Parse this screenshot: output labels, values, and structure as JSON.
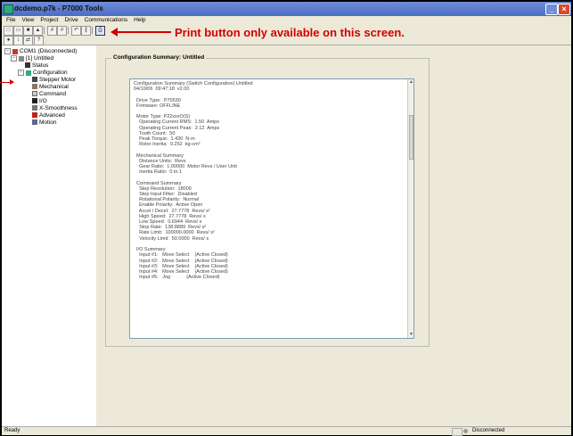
{
  "window": {
    "title": "dcdemo.p7k - P7000 Tools"
  },
  "menu": [
    "File",
    "View",
    "Project",
    "Drive",
    "Communications",
    "Help"
  ],
  "annotation": {
    "text": "Print button only available on this screen."
  },
  "tree": {
    "root": "COM1 (Disconnected)",
    "drive": "[1] Untitled",
    "status": "Status",
    "configuration": "Configuration",
    "items": [
      "Stepper Motor",
      "Mechanical",
      "Command",
      "I/O",
      "X-Smoothness",
      "Advanced",
      "Motion"
    ]
  },
  "panel": {
    "title": "Configuration Summary: Untitled",
    "lines": [
      "Configuration Summary (Switch Configuration) Untitled",
      "04/10/06  09:47:18  v2.00",
      "",
      "  Drive Type:  P70530",
      "  Firmware: OFFLINE",
      "",
      "  Motor Type: P22xxxO(S)",
      "    Operating Current RMS:  1.50  Amps",
      "    Operating Current Peak:  2.12  Amps",
      "    Tooth Count:  50",
      "    Peak Torque:  1.430  N·m",
      "    Rotor Inertia:  0.252  kg-cm²",
      "",
      "  Mechanical Summary",
      "    Distance Units:  Revs",
      "    Gear Ratio:  1.00000  Motor Revs / User Unit",
      "    Inertia Ratio:  0 to 1",
      "",
      "  Command Summary",
      "    Step Resolution:  18000",
      "    Step Input Filter:  Disabled",
      "    Rotational Polarity:  Normal",
      "    Enable Polarity:  Active Open",
      "    Accel / Decel:  27.7778  Revs/ s²",
      "    High Speed:  27.7778  Revs/ s",
      "    Low Speed:  0.6944  Revs/ s",
      "    Stop Rate:  138.8889  Revs/ s²",
      "    Rate Limit:  100000.0000  Revs/ s²",
      "    Velocity Limit:  50.0000  Revs/ s",
      "",
      "  I/O Summary",
      "    Input #1:   Move Select    (Active Closed)",
      "    Input #2:   Move Select    (Active Closed)",
      "    Input #3:   Move Select    (Active Closed)",
      "    Input #4:   Move Select    (Active Closed)",
      "    Input #5:   Jog            (Active Closed)"
    ]
  },
  "statusbar": {
    "ready": "Ready",
    "connection": "Disconnected"
  },
  "colors": {
    "annotation": "#d40000",
    "titlebar": "#4a6cc4"
  }
}
